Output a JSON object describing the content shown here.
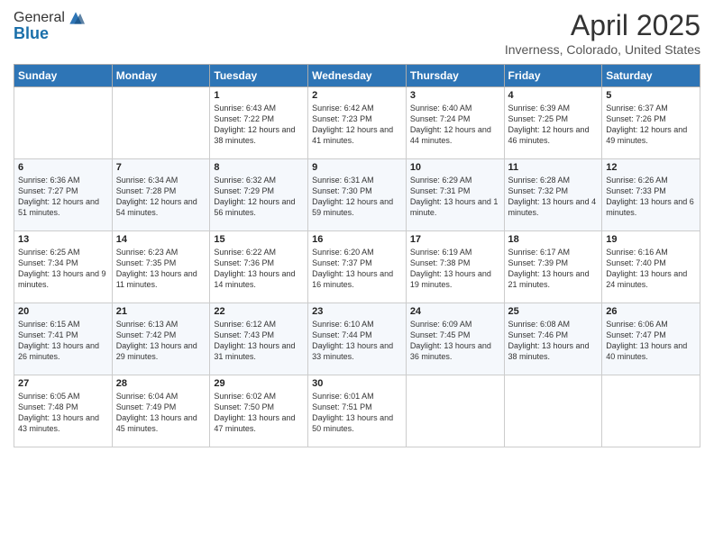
{
  "logo": {
    "general": "General",
    "blue": "Blue"
  },
  "header": {
    "title": "April 2025",
    "subtitle": "Inverness, Colorado, United States"
  },
  "days_of_week": [
    "Sunday",
    "Monday",
    "Tuesday",
    "Wednesday",
    "Thursday",
    "Friday",
    "Saturday"
  ],
  "weeks": [
    [
      {
        "day": "",
        "sunrise": "",
        "sunset": "",
        "daylight": ""
      },
      {
        "day": "",
        "sunrise": "",
        "sunset": "",
        "daylight": ""
      },
      {
        "day": "1",
        "sunrise": "Sunrise: 6:43 AM",
        "sunset": "Sunset: 7:22 PM",
        "daylight": "Daylight: 12 hours and 38 minutes."
      },
      {
        "day": "2",
        "sunrise": "Sunrise: 6:42 AM",
        "sunset": "Sunset: 7:23 PM",
        "daylight": "Daylight: 12 hours and 41 minutes."
      },
      {
        "day": "3",
        "sunrise": "Sunrise: 6:40 AM",
        "sunset": "Sunset: 7:24 PM",
        "daylight": "Daylight: 12 hours and 44 minutes."
      },
      {
        "day": "4",
        "sunrise": "Sunrise: 6:39 AM",
        "sunset": "Sunset: 7:25 PM",
        "daylight": "Daylight: 12 hours and 46 minutes."
      },
      {
        "day": "5",
        "sunrise": "Sunrise: 6:37 AM",
        "sunset": "Sunset: 7:26 PM",
        "daylight": "Daylight: 12 hours and 49 minutes."
      }
    ],
    [
      {
        "day": "6",
        "sunrise": "Sunrise: 6:36 AM",
        "sunset": "Sunset: 7:27 PM",
        "daylight": "Daylight: 12 hours and 51 minutes."
      },
      {
        "day": "7",
        "sunrise": "Sunrise: 6:34 AM",
        "sunset": "Sunset: 7:28 PM",
        "daylight": "Daylight: 12 hours and 54 minutes."
      },
      {
        "day": "8",
        "sunrise": "Sunrise: 6:32 AM",
        "sunset": "Sunset: 7:29 PM",
        "daylight": "Daylight: 12 hours and 56 minutes."
      },
      {
        "day": "9",
        "sunrise": "Sunrise: 6:31 AM",
        "sunset": "Sunset: 7:30 PM",
        "daylight": "Daylight: 12 hours and 59 minutes."
      },
      {
        "day": "10",
        "sunrise": "Sunrise: 6:29 AM",
        "sunset": "Sunset: 7:31 PM",
        "daylight": "Daylight: 13 hours and 1 minute."
      },
      {
        "day": "11",
        "sunrise": "Sunrise: 6:28 AM",
        "sunset": "Sunset: 7:32 PM",
        "daylight": "Daylight: 13 hours and 4 minutes."
      },
      {
        "day": "12",
        "sunrise": "Sunrise: 6:26 AM",
        "sunset": "Sunset: 7:33 PM",
        "daylight": "Daylight: 13 hours and 6 minutes."
      }
    ],
    [
      {
        "day": "13",
        "sunrise": "Sunrise: 6:25 AM",
        "sunset": "Sunset: 7:34 PM",
        "daylight": "Daylight: 13 hours and 9 minutes."
      },
      {
        "day": "14",
        "sunrise": "Sunrise: 6:23 AM",
        "sunset": "Sunset: 7:35 PM",
        "daylight": "Daylight: 13 hours and 11 minutes."
      },
      {
        "day": "15",
        "sunrise": "Sunrise: 6:22 AM",
        "sunset": "Sunset: 7:36 PM",
        "daylight": "Daylight: 13 hours and 14 minutes."
      },
      {
        "day": "16",
        "sunrise": "Sunrise: 6:20 AM",
        "sunset": "Sunset: 7:37 PM",
        "daylight": "Daylight: 13 hours and 16 minutes."
      },
      {
        "day": "17",
        "sunrise": "Sunrise: 6:19 AM",
        "sunset": "Sunset: 7:38 PM",
        "daylight": "Daylight: 13 hours and 19 minutes."
      },
      {
        "day": "18",
        "sunrise": "Sunrise: 6:17 AM",
        "sunset": "Sunset: 7:39 PM",
        "daylight": "Daylight: 13 hours and 21 minutes."
      },
      {
        "day": "19",
        "sunrise": "Sunrise: 6:16 AM",
        "sunset": "Sunset: 7:40 PM",
        "daylight": "Daylight: 13 hours and 24 minutes."
      }
    ],
    [
      {
        "day": "20",
        "sunrise": "Sunrise: 6:15 AM",
        "sunset": "Sunset: 7:41 PM",
        "daylight": "Daylight: 13 hours and 26 minutes."
      },
      {
        "day": "21",
        "sunrise": "Sunrise: 6:13 AM",
        "sunset": "Sunset: 7:42 PM",
        "daylight": "Daylight: 13 hours and 29 minutes."
      },
      {
        "day": "22",
        "sunrise": "Sunrise: 6:12 AM",
        "sunset": "Sunset: 7:43 PM",
        "daylight": "Daylight: 13 hours and 31 minutes."
      },
      {
        "day": "23",
        "sunrise": "Sunrise: 6:10 AM",
        "sunset": "Sunset: 7:44 PM",
        "daylight": "Daylight: 13 hours and 33 minutes."
      },
      {
        "day": "24",
        "sunrise": "Sunrise: 6:09 AM",
        "sunset": "Sunset: 7:45 PM",
        "daylight": "Daylight: 13 hours and 36 minutes."
      },
      {
        "day": "25",
        "sunrise": "Sunrise: 6:08 AM",
        "sunset": "Sunset: 7:46 PM",
        "daylight": "Daylight: 13 hours and 38 minutes."
      },
      {
        "day": "26",
        "sunrise": "Sunrise: 6:06 AM",
        "sunset": "Sunset: 7:47 PM",
        "daylight": "Daylight: 13 hours and 40 minutes."
      }
    ],
    [
      {
        "day": "27",
        "sunrise": "Sunrise: 6:05 AM",
        "sunset": "Sunset: 7:48 PM",
        "daylight": "Daylight: 13 hours and 43 minutes."
      },
      {
        "day": "28",
        "sunrise": "Sunrise: 6:04 AM",
        "sunset": "Sunset: 7:49 PM",
        "daylight": "Daylight: 13 hours and 45 minutes."
      },
      {
        "day": "29",
        "sunrise": "Sunrise: 6:02 AM",
        "sunset": "Sunset: 7:50 PM",
        "daylight": "Daylight: 13 hours and 47 minutes."
      },
      {
        "day": "30",
        "sunrise": "Sunrise: 6:01 AM",
        "sunset": "Sunset: 7:51 PM",
        "daylight": "Daylight: 13 hours and 50 minutes."
      },
      {
        "day": "",
        "sunrise": "",
        "sunset": "",
        "daylight": ""
      },
      {
        "day": "",
        "sunrise": "",
        "sunset": "",
        "daylight": ""
      },
      {
        "day": "",
        "sunrise": "",
        "sunset": "",
        "daylight": ""
      }
    ]
  ]
}
